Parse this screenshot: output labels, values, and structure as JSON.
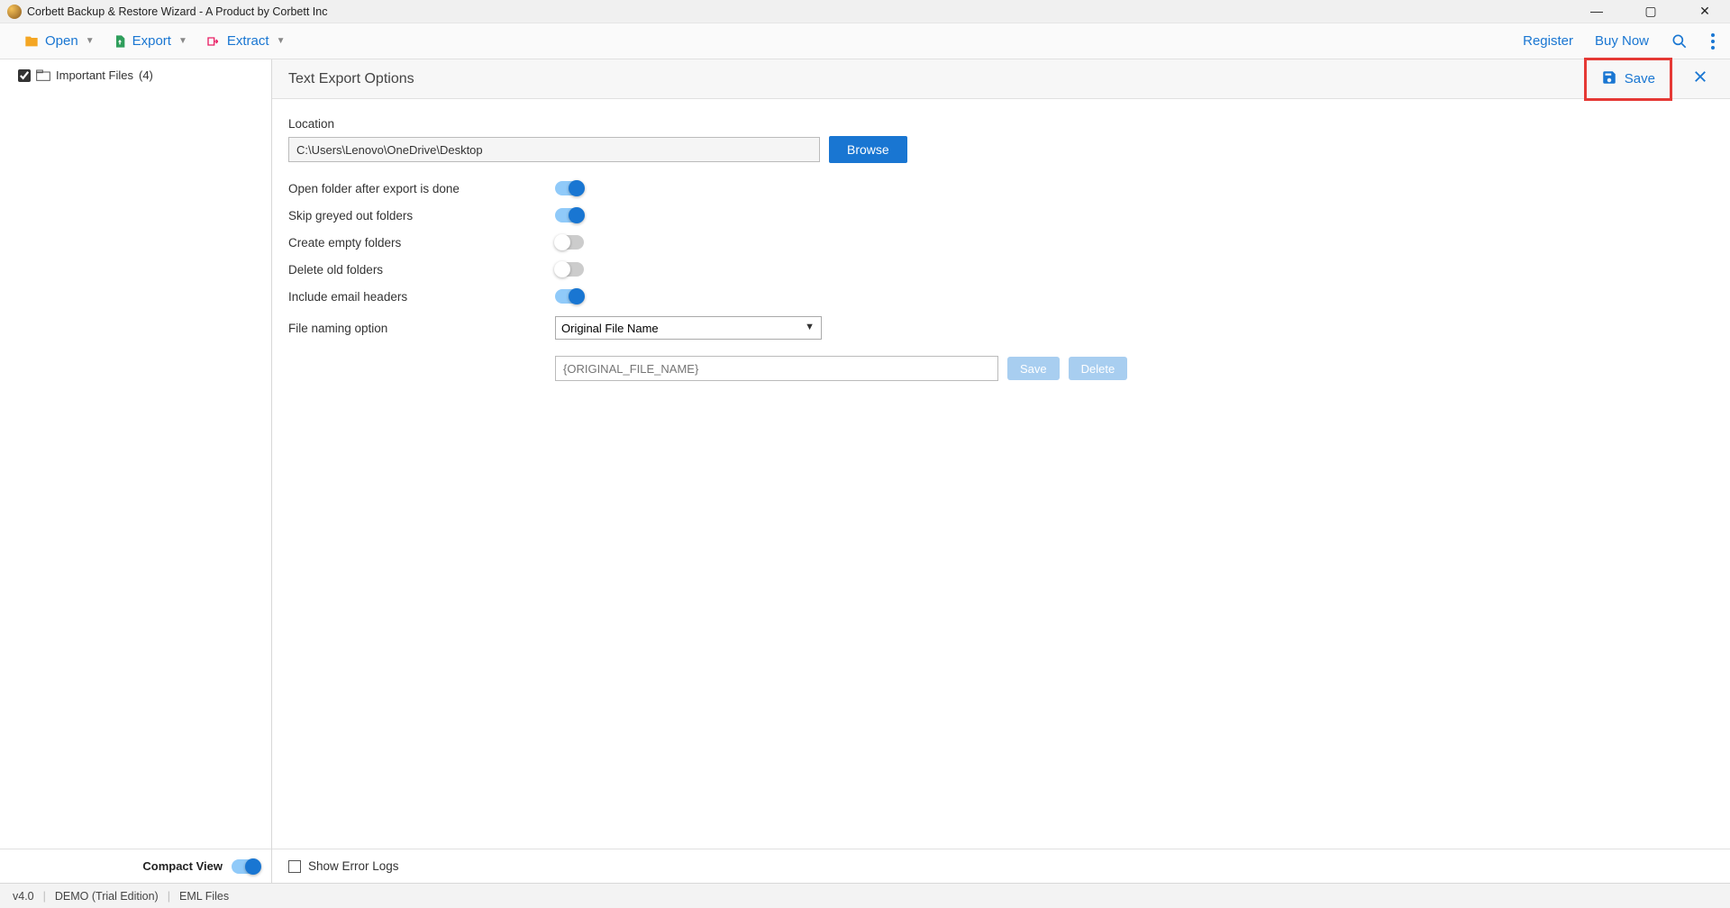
{
  "app_title": "Corbett Backup & Restore Wizard - A Product by Corbett Inc",
  "toolbar": {
    "open": "Open",
    "export": "Export",
    "extract": "Extract",
    "register": "Register",
    "buy_now": "Buy Now"
  },
  "sidebar": {
    "tree_item_label": "Important Files",
    "tree_item_count": "(4)",
    "compact_view_label": "Compact View",
    "compact_view_on": true
  },
  "panel": {
    "title": "Text Export Options",
    "save_label": "Save",
    "location_label": "Location",
    "location_value": "C:\\Users\\Lenovo\\OneDrive\\Desktop",
    "browse_label": "Browse",
    "options": [
      {
        "label": "Open folder after export is done",
        "on": true
      },
      {
        "label": "Skip greyed out folders",
        "on": true
      },
      {
        "label": "Create empty folders",
        "on": false
      },
      {
        "label": "Delete old folders",
        "on": false
      },
      {
        "label": "Include email headers",
        "on": true
      }
    ],
    "file_naming_label": "File naming option",
    "file_naming_selected": "Original File Name",
    "naming_placeholder": "{ORIGINAL_FILE_NAME}",
    "mini_save": "Save",
    "mini_delete": "Delete",
    "show_error_logs": "Show Error Logs"
  },
  "status": {
    "version": "v4.0",
    "edition": "DEMO (Trial Edition)",
    "file_type": "EML Files"
  }
}
